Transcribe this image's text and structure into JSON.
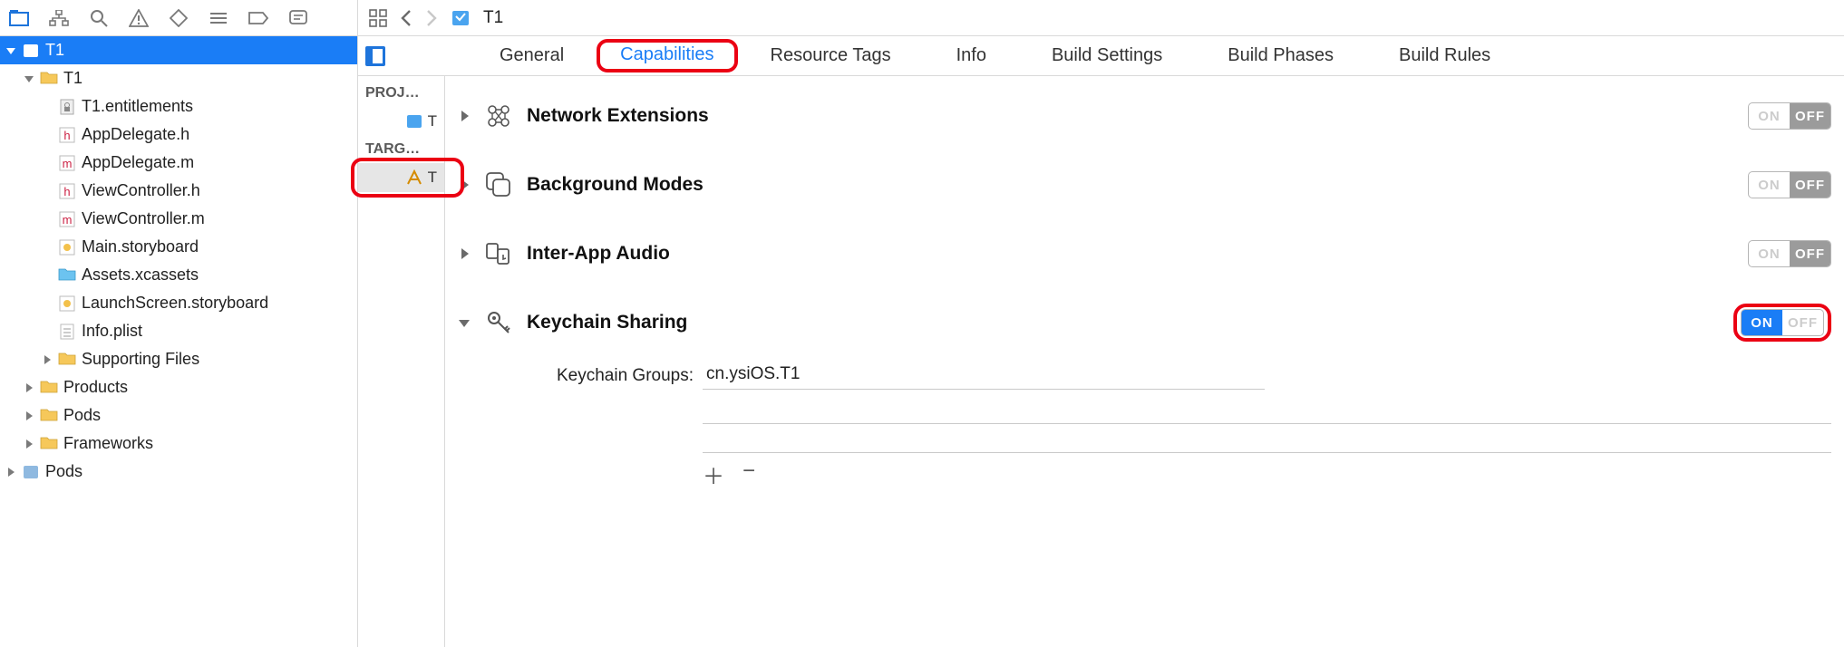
{
  "navigator": {
    "tools": [
      "files",
      "symbols",
      "search",
      "warnings",
      "tests",
      "debug",
      "breakpoints",
      "reports"
    ],
    "tree": [
      {
        "indent": 0,
        "label": "T1",
        "icon": "proj",
        "sel": true,
        "open": true
      },
      {
        "indent": 1,
        "label": "T1",
        "icon": "folder",
        "open": true
      },
      {
        "indent": 2,
        "label": "T1.entitlements",
        "icon": "entitle"
      },
      {
        "indent": 2,
        "label": "AppDelegate.h",
        "icon": "h"
      },
      {
        "indent": 2,
        "label": "AppDelegate.m",
        "icon": "m"
      },
      {
        "indent": 2,
        "label": "ViewController.h",
        "icon": "h"
      },
      {
        "indent": 2,
        "label": "ViewController.m",
        "icon": "m"
      },
      {
        "indent": 2,
        "label": "Main.storyboard",
        "icon": "storyboard"
      },
      {
        "indent": 2,
        "label": "Assets.xcassets",
        "icon": "assets"
      },
      {
        "indent": 2,
        "label": "LaunchScreen.storyboard",
        "icon": "storyboard"
      },
      {
        "indent": 2,
        "label": "Info.plist",
        "icon": "plist"
      },
      {
        "indent": 2,
        "label": "Supporting Files",
        "icon": "folder",
        "closed": true
      },
      {
        "indent": 1,
        "label": "Products",
        "icon": "folder",
        "closed": true
      },
      {
        "indent": 1,
        "label": "Pods",
        "icon": "folder",
        "closed": true
      },
      {
        "indent": 1,
        "label": "Frameworks",
        "icon": "folder",
        "closed": true
      },
      {
        "indent": 0,
        "label": "Pods",
        "icon": "proj-grey",
        "closed": true
      }
    ]
  },
  "jumpbar": {
    "title": "T1"
  },
  "tabs": [
    "General",
    "Capabilities",
    "Resource Tags",
    "Info",
    "Build Settings",
    "Build Phases",
    "Build Rules"
  ],
  "active_tab": "Capabilities",
  "outline": {
    "project_head": "PROJ…",
    "project_item": "T",
    "target_head": "TARG…",
    "target_item": "T"
  },
  "capabilities": [
    {
      "name": "Network Extensions",
      "state": "off",
      "icon": "network",
      "open": false
    },
    {
      "name": "Background Modes",
      "state": "off",
      "icon": "layers",
      "open": false
    },
    {
      "name": "Inter-App Audio",
      "state": "off",
      "icon": "audio",
      "open": false
    },
    {
      "name": "Keychain Sharing",
      "state": "on",
      "icon": "key",
      "open": true,
      "highlight": true
    }
  ],
  "keychain": {
    "label": "Keychain Groups:",
    "value": "cn.ysiOS.T1"
  },
  "toggle_labels": {
    "on": "ON",
    "off": "OFF"
  }
}
